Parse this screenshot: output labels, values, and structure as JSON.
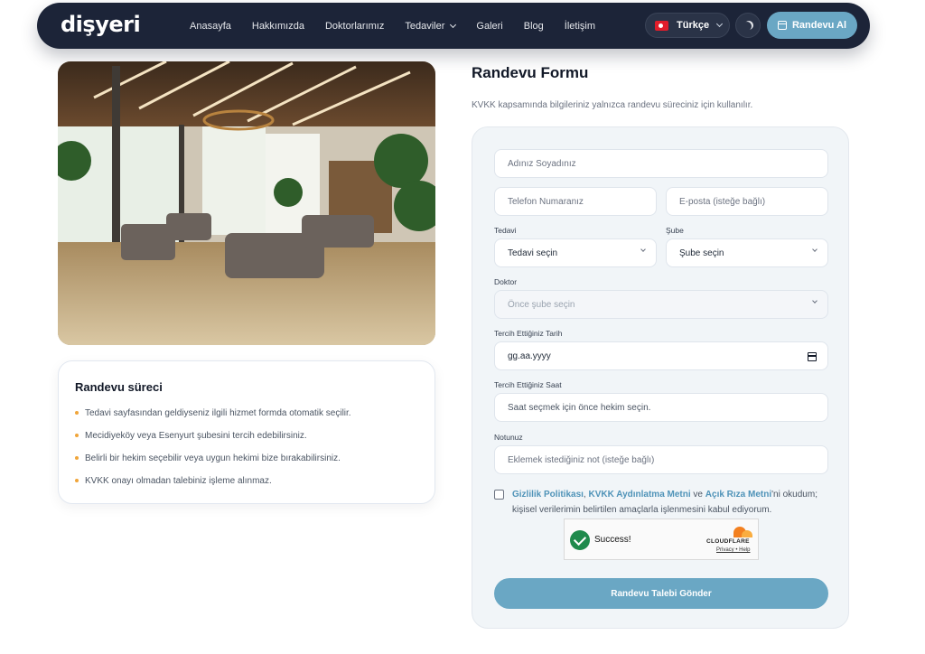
{
  "brand": {
    "logo": "dişyeri"
  },
  "nav": {
    "items": [
      {
        "label": "Anasayfa"
      },
      {
        "label": "Hakkımızda"
      },
      {
        "label": "Doktorlarımız"
      },
      {
        "label": "Tedaviler"
      },
      {
        "label": "Galeri"
      },
      {
        "label": "Blog"
      },
      {
        "label": "İletişim"
      }
    ],
    "language": "Türkçe",
    "cta_label": "Randevu Al"
  },
  "process": {
    "title": "Randevu süreci",
    "items": [
      "Tedavi sayfasından geldiyseniz ilgili hizmet formda otomatik seçilir.",
      "Mecidiyeköy veya Esenyurt şubesini tercih edebilirsiniz.",
      "Belirli bir hekim seçebilir veya uygun hekimi bize bırakabilirsiniz.",
      "KVKK onayı olmadan talebiniz işleme alınmaz."
    ]
  },
  "form": {
    "title": "Randevu Formu",
    "subtitle": "KVKK kapsamında bilgileriniz yalnızca randevu süreciniz için kullanılır.",
    "name_placeholder": "Adınız Soyadınız",
    "phone_placeholder": "Telefon Numaranız",
    "email_placeholder": "E-posta (isteğe bağlı)",
    "treatment_label": "Tedavi",
    "treatment_value": "Tedavi seçin",
    "branch_label": "Şube",
    "branch_value": "Şube seçin",
    "doctor_label": "Doktor",
    "doctor_value": "Önce şube seçin",
    "date_label": "Tercih Ettiğiniz Tarih",
    "date_value": "gg.aa.yyyy",
    "time_label": "Tercih Ettiğiniz Saat",
    "time_value": "Saat seçmek için önce hekim seçin.",
    "note_label": "Notunuz",
    "note_placeholder": "Eklemek istediğiniz not (isteğe bağlı)",
    "consent": {
      "link1": "Gizlilik Politikası",
      "sep1": ", ",
      "link2": "KVKK Aydınlatma Metni",
      "sep2": " ve ",
      "link3": "Açık Rıza Metni",
      "rest": "'ni okudum; kişisel verilerimin belirtilen amaçlarla işlenmesini kabul ediyorum."
    },
    "captcha": {
      "status": "Success!",
      "provider": "CLOUDFLARE",
      "links": "Privacy • Help"
    },
    "submit_label": "Randevu Talebi Gönder"
  },
  "colors": {
    "nav_bg": "#1c2438",
    "accent": "#6aa7c4",
    "bullet": "#f0a53a",
    "link": "#4f93b8"
  }
}
